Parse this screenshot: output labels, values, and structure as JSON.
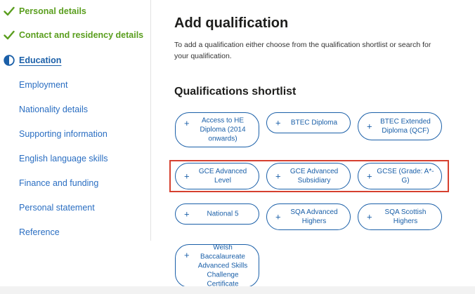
{
  "sidebar": {
    "items": [
      {
        "label": "Personal details",
        "state": "done"
      },
      {
        "label": "Contact and residency details",
        "state": "done"
      },
      {
        "label": "Education",
        "state": "current"
      },
      {
        "label": "Employment",
        "state": "todo"
      },
      {
        "label": "Nationality details",
        "state": "todo"
      },
      {
        "label": "Supporting information",
        "state": "todo"
      },
      {
        "label": "English language skills",
        "state": "todo"
      },
      {
        "label": "Finance and funding",
        "state": "todo"
      },
      {
        "label": "Personal statement",
        "state": "todo"
      },
      {
        "label": "Reference",
        "state": "todo"
      }
    ]
  },
  "main": {
    "title": "Add qualification",
    "intro": "To add a qualification either choose from the qualification shortlist or search for your qualification.",
    "shortlist_title": "Qualifications shortlist",
    "plus_symbol": "+",
    "qualifications": [
      {
        "label": "Access to HE Diploma (2014 onwards)"
      },
      {
        "label": "BTEC Diploma"
      },
      {
        "label": "BTEC Extended Diploma (QCF)"
      },
      {
        "label": "GCE Advanced Level"
      },
      {
        "label": "GCE Advanced Subsidiary"
      },
      {
        "label": "GCSE (Grade: A*-G)"
      },
      {
        "label": "National 5"
      },
      {
        "label": "SQA Advanced Highers"
      },
      {
        "label": "SQA Scottish Highers"
      },
      {
        "label": "Welsh Baccalaureate Advanced Skills Challenge Certificate"
      }
    ]
  },
  "colors": {
    "done": "#5a9e1e",
    "link": "#2a6ec2",
    "chip_border": "#1a5fa8",
    "highlight": "#d6402f"
  },
  "icons": {
    "done": "check-icon",
    "current": "half-circle-icon"
  }
}
